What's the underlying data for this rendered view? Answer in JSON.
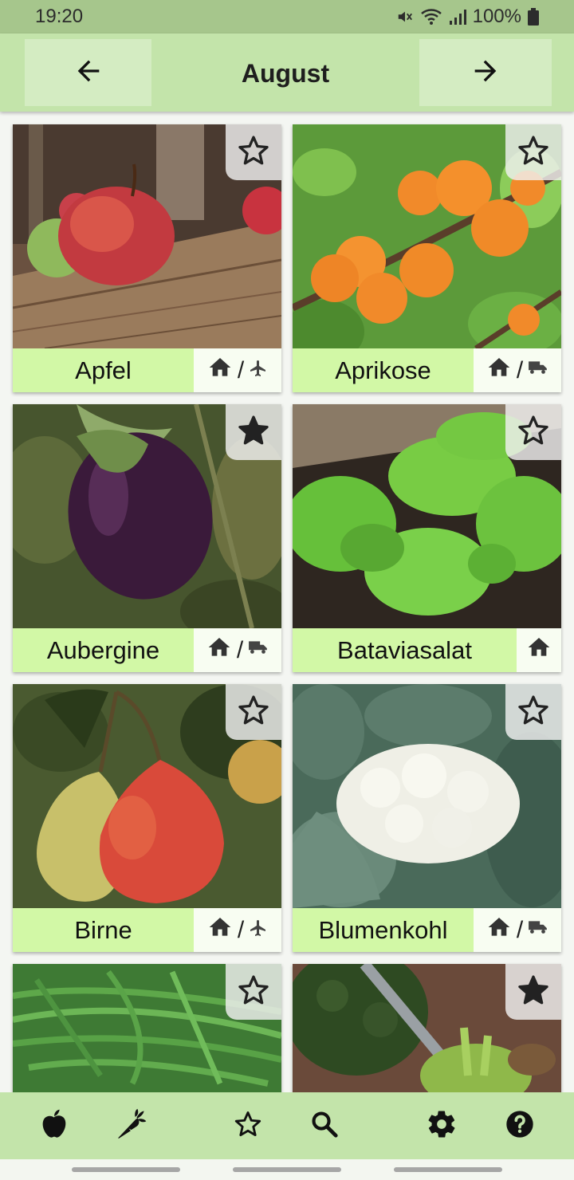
{
  "status_bar": {
    "time": "19:20",
    "battery": "100%"
  },
  "header": {
    "title": "August"
  },
  "cards": [
    {
      "name": "Apfel",
      "favorite": false,
      "origin": [
        "home-icon",
        "plane-icon"
      ]
    },
    {
      "name": "Aprikose",
      "favorite": false,
      "origin": [
        "home-icon",
        "truck-icon"
      ]
    },
    {
      "name": "Aubergine",
      "favorite": true,
      "origin": [
        "home-icon",
        "truck-icon"
      ]
    },
    {
      "name": "Bataviasalat",
      "favorite": false,
      "origin": [
        "home-icon"
      ]
    },
    {
      "name": "Birne",
      "favorite": false,
      "origin": [
        "home-icon",
        "plane-icon"
      ]
    },
    {
      "name": "Blumenkohl",
      "favorite": false,
      "origin": [
        "home-icon",
        "truck-icon"
      ]
    },
    {
      "name": "",
      "favorite": false,
      "origin": []
    },
    {
      "name": "",
      "favorite": true,
      "origin": []
    }
  ],
  "origin_separator": "/",
  "bottom_nav": [
    "apple-icon",
    "carrot-icon",
    "star-icon",
    "search-icon",
    "gear-icon",
    "help-icon"
  ],
  "colors": {
    "app_bar": "#c3e4aa",
    "label_bg": "#d2f8a6",
    "status_bar": "#a6c68c"
  }
}
